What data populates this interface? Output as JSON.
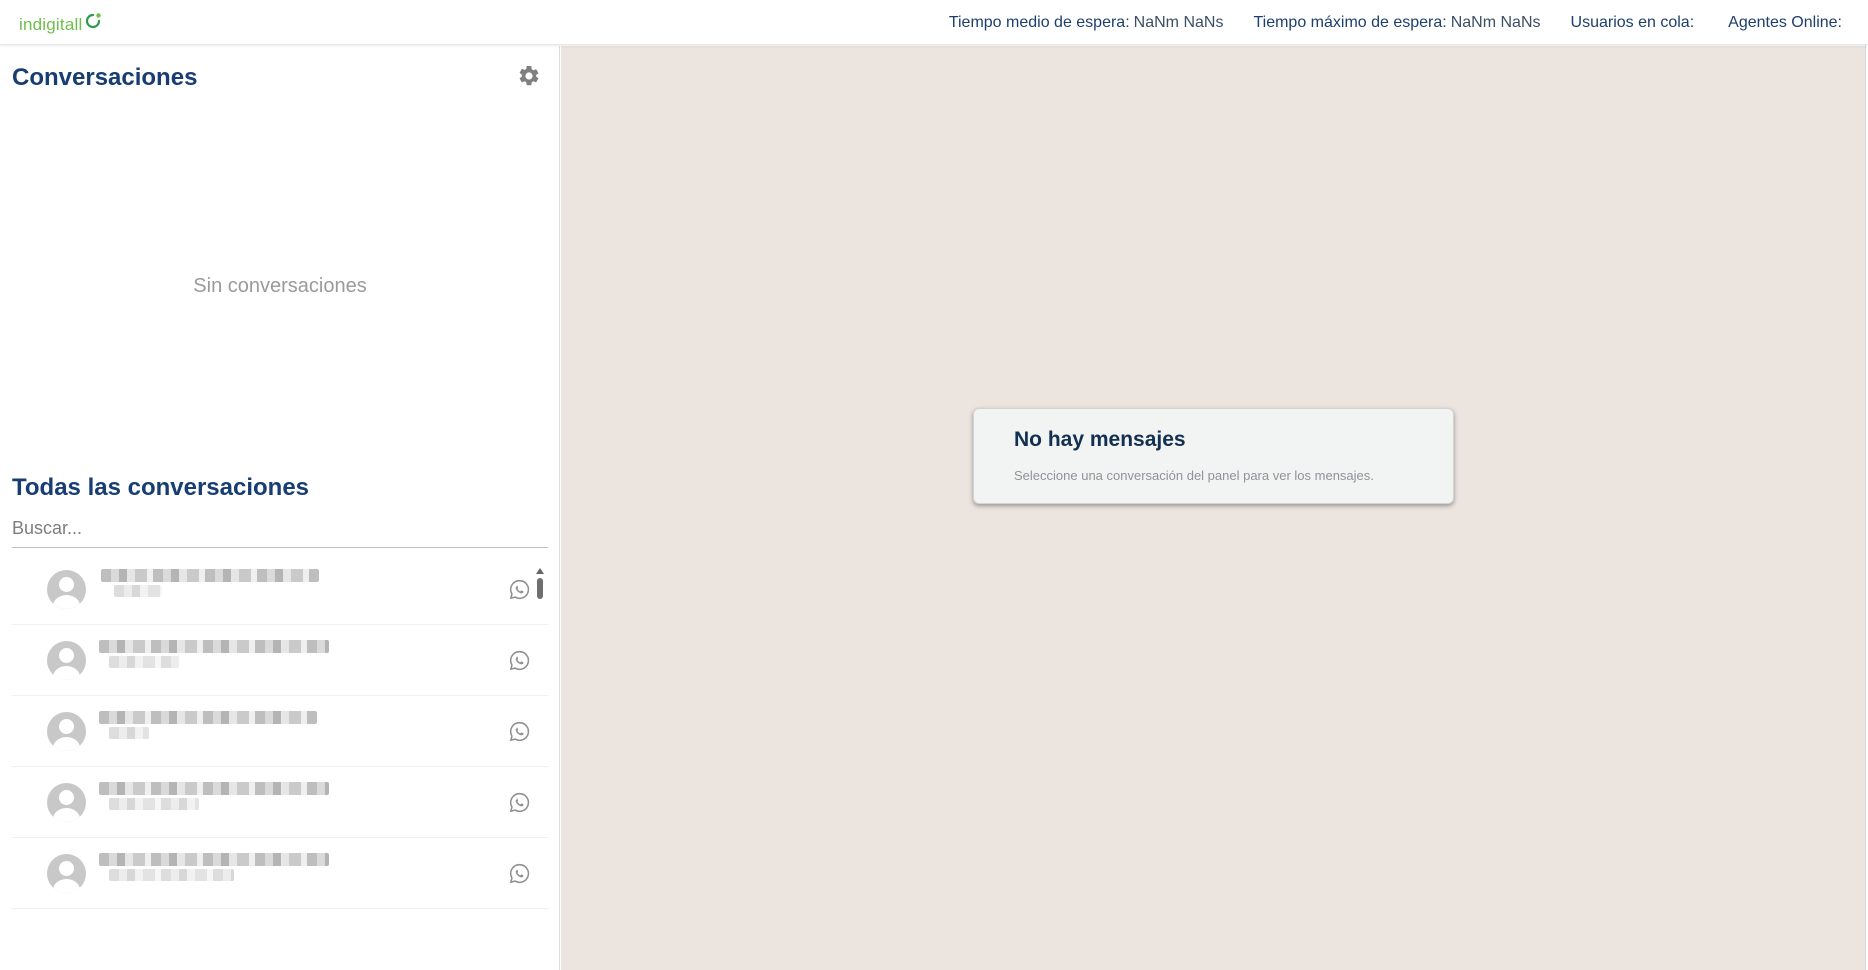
{
  "header": {
    "logo_text": "indigitall",
    "stats": [
      {
        "label": "Tiempo medio de espera:",
        "value": "NaNm NaNs"
      },
      {
        "label": "Tiempo máximo de espera:",
        "value": "NaNm NaNs"
      },
      {
        "label": "Usuarios en cola:",
        "value": ""
      },
      {
        "label": "Agentes Online:",
        "value": ""
      }
    ]
  },
  "sidebar": {
    "conversations_title": "Conversaciones",
    "empty_text": "Sin conversaciones",
    "all_title": "Todas las conversaciones",
    "search_placeholder": "Buscar...",
    "conversation_count": 5,
    "channel_icon": "whatsapp-icon",
    "settings_icon": "gear-icon"
  },
  "main": {
    "card_title": "No hay mensajes",
    "card_text": "Seleccione una conversación del panel para ver los mensajes."
  },
  "colors": {
    "brand_green": "#6cc04a",
    "title_blue": "#173d73",
    "chat_background": "#ebe4df"
  }
}
